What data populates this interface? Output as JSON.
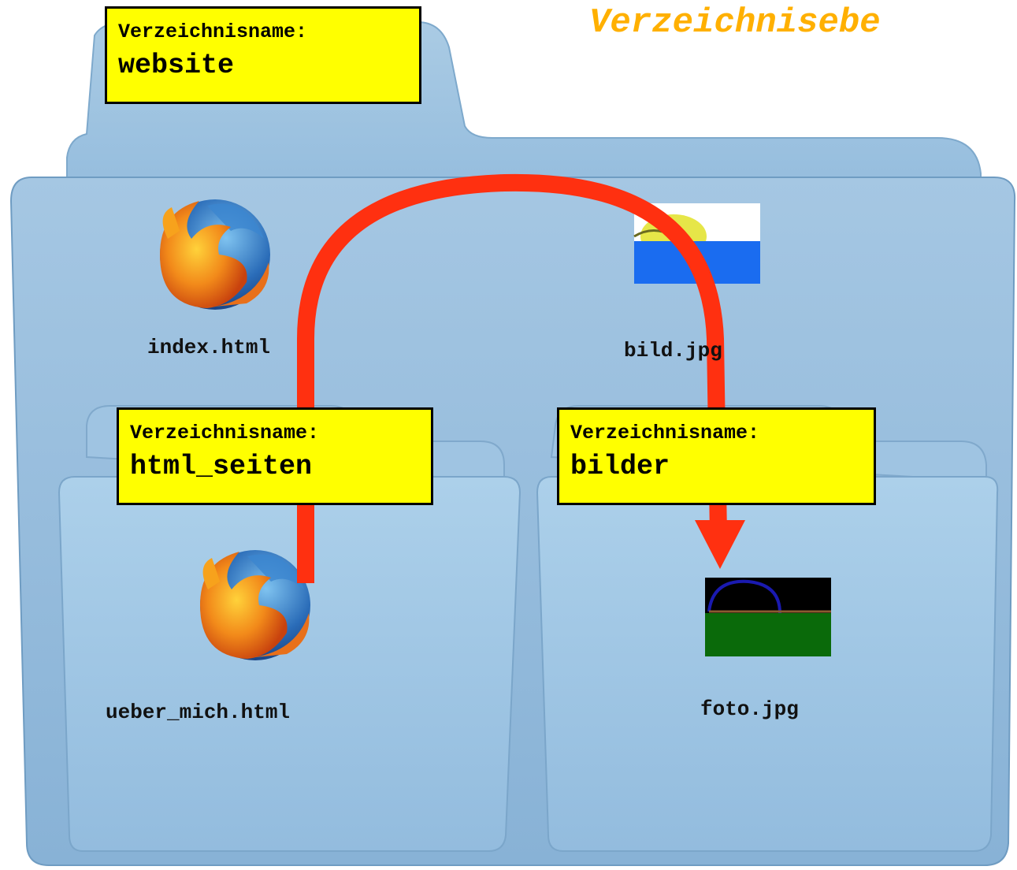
{
  "title": "Verzeichnisebe",
  "colors": {
    "folder_fill": "#9dc2e0",
    "folder_dark": "#7ea9cc",
    "label_bg": "#ffff00",
    "arrow": "#ff3010",
    "title": "#ffb000"
  },
  "root_folder": {
    "caption": "Verzeichnisname:",
    "name": "website",
    "files": [
      {
        "name": "index.html",
        "icon": "firefox-icon"
      },
      {
        "name": "bild.jpg",
        "icon": "landscape-image-icon"
      }
    ]
  },
  "subfolders": [
    {
      "caption": "Verzeichnisname:",
      "name": "html_seiten",
      "files": [
        {
          "name": "ueber_mich.html",
          "icon": "firefox-icon"
        }
      ]
    },
    {
      "caption": "Verzeichnisname:",
      "name": "bilder",
      "files": [
        {
          "name": "foto.jpg",
          "icon": "dark-photo-icon"
        }
      ]
    }
  ]
}
